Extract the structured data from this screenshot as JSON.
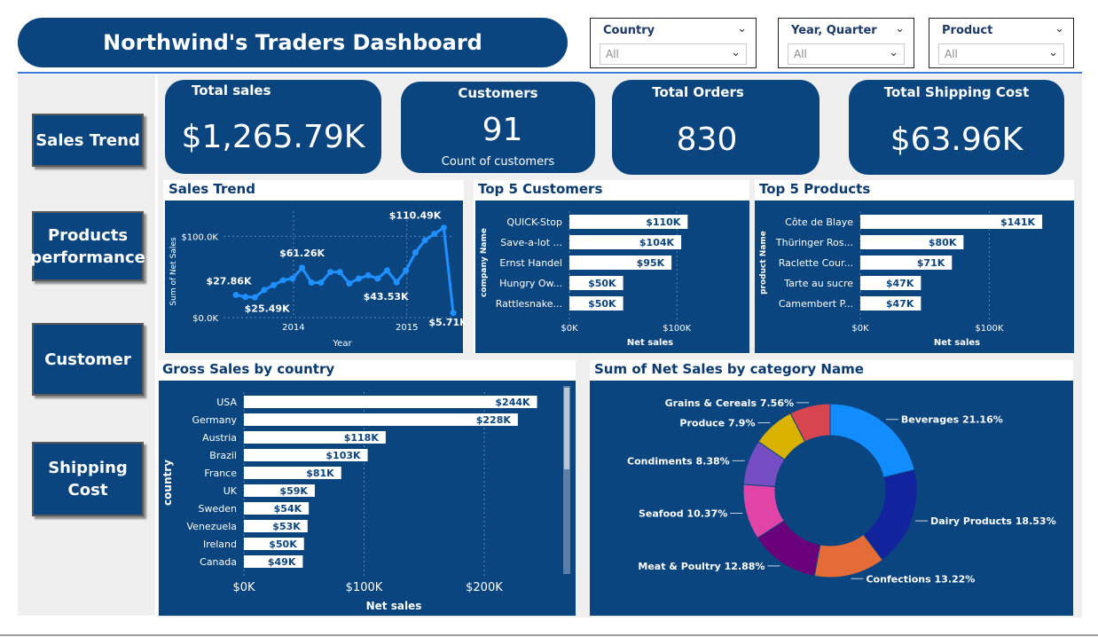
{
  "title": "Northwind's Traders Dashboard",
  "filters": [
    {
      "label": "Country",
      "value": "All"
    },
    {
      "label": "Year, Quarter",
      "value": "All"
    },
    {
      "label": "Product",
      "value": "All"
    }
  ],
  "nav": {
    "sales_trend": "Sales Trend",
    "products_line1": "Products",
    "products_line2": "performance",
    "customer": "Customer",
    "shipping_line1": "Shipping",
    "shipping_line2": "Cost"
  },
  "kpis": {
    "total_sales": {
      "label": "Total sales",
      "value": "$1,265.79K"
    },
    "customers": {
      "label": "Customers",
      "value": "91",
      "sub": "Count of customers"
    },
    "total_orders": {
      "label": "Total Orders",
      "value": "830"
    },
    "shipping": {
      "label": "Total Shipping Cost",
      "value": "$63.96K"
    }
  },
  "panels": {
    "sales_trend": "Sales Trend",
    "top_customers": "Top 5 Customers",
    "top_products": "Top 5 Products",
    "gross_country": "Gross Sales by country",
    "category": "Sum of Net Sales by category Name"
  },
  "colors": {
    "navy": "#0a4580",
    "line": "#1e90ff",
    "bar": "#ffffff"
  },
  "chart_data": [
    {
      "type": "line",
      "title": "Sales Trend",
      "xlabel": "Year",
      "ylabel": "Sum of Net Sales",
      "x_ticks": [
        "2014",
        "2015"
      ],
      "y_ticks": [
        "$0.0K",
        "$100.0K"
      ],
      "ylim": [
        0,
        120
      ],
      "values": [
        27.86,
        25.49,
        25.0,
        34.0,
        40.0,
        46.0,
        48.0,
        61.26,
        43.0,
        43.0,
        56.0,
        56.0,
        42.0,
        48.0,
        52.0,
        48.0,
        58.0,
        43.53,
        58.0,
        80.0,
        95.0,
        103.0,
        110.49,
        5.71
      ],
      "labels": [
        {
          "index": 0,
          "text": "$27.86K"
        },
        {
          "index": 1,
          "text": "$25.49K"
        },
        {
          "index": 7,
          "text": "$61.26K"
        },
        {
          "index": 17,
          "text": "$43.53K"
        },
        {
          "index": 22,
          "text": "$110.49K"
        },
        {
          "index": 23,
          "text": "$5.71K"
        }
      ]
    },
    {
      "type": "bar",
      "orientation": "horizontal",
      "title": "Top 5 Customers",
      "ylabel": "company Name",
      "xlabel": "Net sales",
      "x_ticks": [
        "$0K",
        "$100K"
      ],
      "xlim": [
        0,
        165
      ],
      "categories": [
        "QUICK-Stop",
        "Save-a-lot ...",
        "Ernst Handel",
        "Hungry Ow...",
        "Rattlesnake..."
      ],
      "values": [
        110,
        104,
        95,
        50,
        50
      ],
      "labels": [
        "$110K",
        "$104K",
        "$95K",
        "$50K",
        "$50K"
      ]
    },
    {
      "type": "bar",
      "orientation": "horizontal",
      "title": "Top 5 Products",
      "ylabel": "product Name",
      "xlabel": "Net sales",
      "x_ticks": [
        "$0K",
        "$100K"
      ],
      "xlim": [
        0,
        165
      ],
      "categories": [
        "Côte de Blaye",
        "Thüringer Ros...",
        "Raclette Cour...",
        "Tarte au sucre",
        "Camembert P..."
      ],
      "values": [
        141,
        80,
        71,
        47,
        47
      ],
      "labels": [
        "$141K",
        "$80K",
        "$71K",
        "$47K",
        "$47K"
      ]
    },
    {
      "type": "bar",
      "orientation": "horizontal",
      "title": "Gross Sales by country",
      "ylabel": "country",
      "xlabel": "Net sales",
      "x_ticks": [
        "$0K",
        "$100K",
        "$200K"
      ],
      "xlim": [
        0,
        265
      ],
      "categories": [
        "USA",
        "Germany",
        "Austria",
        "Brazil",
        "France",
        "UK",
        "Sweden",
        "Venezuela",
        "Ireland",
        "Canada"
      ],
      "values": [
        244,
        228,
        118,
        103,
        81,
        59,
        54,
        53,
        50,
        49
      ],
      "labels": [
        "$244K",
        "$228K",
        "$118K",
        "$103K",
        "$81K",
        "$59K",
        "$54K",
        "$53K",
        "$50K",
        "$49K"
      ]
    },
    {
      "type": "pie",
      "subtype": "donut",
      "title": "Sum of Net Sales by category Name",
      "categories": [
        "Beverages",
        "Dairy Products",
        "Confections",
        "Meat & Poultry",
        "Seafood",
        "Condiments",
        "Produce",
        "Grains & Cereals"
      ],
      "values": [
        21.16,
        18.53,
        13.22,
        12.88,
        10.37,
        8.38,
        7.9,
        7.56
      ],
      "labels": [
        "Beverages 21.16%",
        "Dairy Products 18.53%",
        "Confections 13.22%",
        "Meat & Poultry 12.88%",
        "Seafood 10.37%",
        "Condiments 8.38%",
        "Produce 7.9%",
        "Grains & Cereals 7.56%"
      ],
      "colors": [
        "#118dff",
        "#12239e",
        "#e66c37",
        "#6b007b",
        "#e044a7",
        "#744ec2",
        "#d9b300",
        "#d64550"
      ]
    }
  ]
}
